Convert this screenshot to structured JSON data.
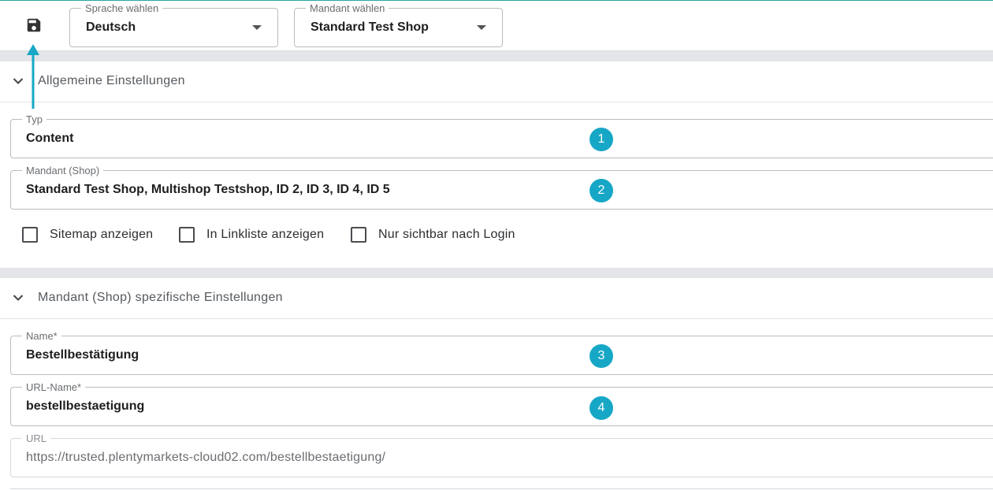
{
  "toolbar": {
    "save_icon": "floppy-disk-icon",
    "language": {
      "legend": "Sprache wählen",
      "value": "Deutsch"
    },
    "client": {
      "legend": "Mandant wählen",
      "value": "Standard Test Shop"
    }
  },
  "general": {
    "title": "Allgemeine Einstellungen",
    "type": {
      "legend": "Typ",
      "value": "Content",
      "badge": "1"
    },
    "client_shop": {
      "legend": "Mandant (Shop)",
      "value": "Standard Test Shop, Multishop Testshop, ID 2, ID 3, ID 4, ID 5",
      "badge": "2"
    },
    "checkboxes": [
      {
        "label": "Sitemap anzeigen",
        "checked": false
      },
      {
        "label": "In Linkliste anzeigen",
        "checked": false
      },
      {
        "label": "Nur sichtbar nach Login",
        "checked": false
      }
    ]
  },
  "specific": {
    "title": "Mandant (Shop) spezifische Einstellungen",
    "name": {
      "legend": "Name*",
      "value": "Bestellbestätigung",
      "badge": "3"
    },
    "url_name": {
      "legend": "URL-Name*",
      "value": "bestellbestaetigung",
      "badge": "4"
    },
    "url": {
      "legend": "URL",
      "value": "https://trusted.plentymarkets-cloud02.com/bestellbestaetigung/"
    }
  },
  "colors": {
    "accent": "#17a7c6",
    "top_border": "#2aa7a0"
  }
}
